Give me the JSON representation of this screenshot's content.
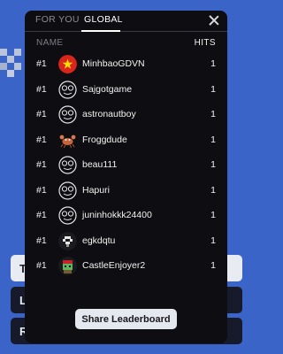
{
  "tabs": [
    {
      "label": "FOR YOU"
    },
    {
      "label": "GLOBAL"
    }
  ],
  "columns": {
    "name": "NAME",
    "hits": "HITS"
  },
  "entries": [
    {
      "rank": "#1",
      "name": "MinhbaoGDVN",
      "hits": "1",
      "avatar": "vietnam-flag-icon"
    },
    {
      "rank": "#1",
      "name": "Sajgotgame",
      "hits": "1",
      "avatar": "default-avatar-icon"
    },
    {
      "rank": "#1",
      "name": "astronautboy",
      "hits": "1",
      "avatar": "default-avatar-icon"
    },
    {
      "rank": "#1",
      "name": "Froggdude",
      "hits": "1",
      "avatar": "crab-avatar-icon"
    },
    {
      "rank": "#1",
      "name": "beau111",
      "hits": "1",
      "avatar": "default-avatar-icon"
    },
    {
      "rank": "#1",
      "name": "Hapuri",
      "hits": "1",
      "avatar": "default-avatar-icon"
    },
    {
      "rank": "#1",
      "name": "juninhokkk24400",
      "hits": "1",
      "avatar": "default-avatar-icon"
    },
    {
      "rank": "#1",
      "name": "egkdqtu",
      "hits": "1",
      "avatar": "pixel-avatar-icon"
    },
    {
      "rank": "#1",
      "name": "CastleEnjoyer2",
      "hits": "1",
      "avatar": "goblin-avatar-icon"
    }
  ],
  "share_label": "Share Leaderboard",
  "background_buttons": [
    "T",
    "L",
    "R"
  ],
  "colors": {
    "page_bg": "#3b64c8",
    "modal_bg": "#0e0e12",
    "button_bg": "#e6e8ef"
  }
}
